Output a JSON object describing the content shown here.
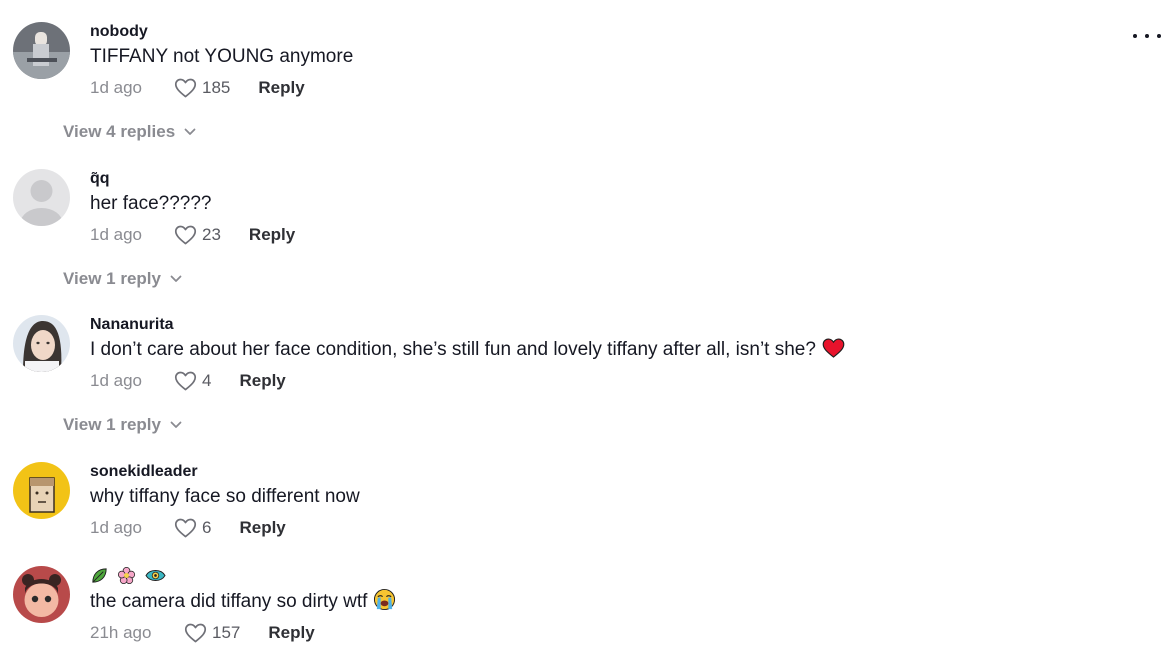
{
  "comments": [
    {
      "username": "nobody",
      "text": "TIFFANY not YOUNG anymore",
      "time": "1d ago",
      "likes": "185",
      "reply_label": "Reply",
      "view_replies": "View 4 replies"
    },
    {
      "username": "q͂q",
      "text": "her face?????",
      "time": "1d ago",
      "likes": "23",
      "reply_label": "Reply",
      "view_replies": "View 1 reply"
    },
    {
      "username": "Nananurita",
      "text": "I don’t care about her face condition, she’s still fun and lovely tiffany after all, isn’t she?",
      "time": "1d ago",
      "likes": "4",
      "reply_label": "Reply",
      "view_replies": "View 1 reply"
    },
    {
      "username": "sonekidleader",
      "text": "why tiffany face so different now",
      "time": "1d ago",
      "likes": "6",
      "reply_label": "Reply"
    },
    {
      "username": "",
      "username_icons": [
        "leaf-emoji-icon",
        "flower-emoji-icon",
        "eye-emoji-icon"
      ],
      "text": "the camera did tiffany so dirty wtf",
      "time": "21h ago",
      "likes": "157",
      "reply_label": "Reply"
    }
  ],
  "colors": {
    "text": "#161823",
    "muted": "#8a8b91",
    "heart": "#e8132c"
  }
}
